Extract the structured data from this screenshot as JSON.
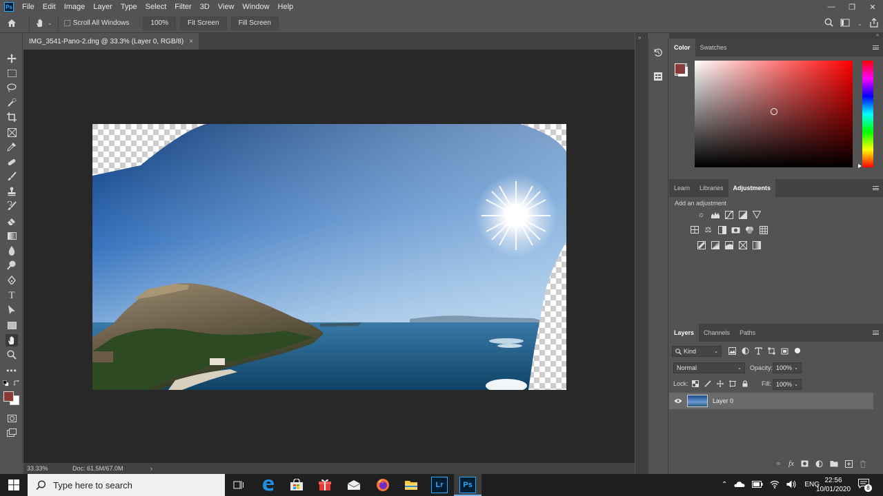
{
  "app": {
    "logo": "Ps",
    "menu": [
      "File",
      "Edit",
      "Image",
      "Layer",
      "Type",
      "Select",
      "Filter",
      "3D",
      "View",
      "Window",
      "Help"
    ],
    "window_controls": [
      "minimize",
      "restore",
      "close"
    ]
  },
  "options_bar": {
    "scroll_all_windows_label": "Scroll All Windows",
    "zoom_value": "100%",
    "fit_screen_label": "Fit Screen",
    "fill_screen_label": "Fill Screen"
  },
  "document": {
    "tab_title": "IMG_3541-Pano-2.dng @ 33.3% (Layer 0, RGB/8)",
    "close_glyph": "×",
    "zoom_status": "33.33%",
    "doc_info": "Doc: 61.5M/67.0M",
    "status_arrow": "›"
  },
  "colors": {
    "foreground": "#8b3a3a",
    "background": "#ffffff",
    "accent": "#31a8ff"
  },
  "color_panel": {
    "tabs": [
      "Color",
      "Swatches"
    ],
    "active_tab": "Color"
  },
  "adjustments_panel": {
    "tabs": [
      "Learn",
      "Libraries",
      "Adjustments"
    ],
    "active_tab": "Adjustments",
    "heading": "Add an adjustment",
    "row1": [
      "brightness-contrast-icon",
      "levels-icon",
      "curves-icon",
      "exposure-icon",
      "vibrance-icon"
    ],
    "row2": [
      "hue-saturation-icon",
      "color-balance-icon",
      "black-white-icon",
      "photo-filter-icon",
      "channel-mixer-icon",
      "color-lookup-icon"
    ],
    "row3": [
      "invert-icon",
      "posterize-icon",
      "threshold-icon",
      "selective-color-icon",
      "gradient-map-icon"
    ]
  },
  "layers_panel": {
    "tabs": [
      "Layers",
      "Channels",
      "Paths"
    ],
    "active_tab": "Layers",
    "filter_kind": "Kind",
    "blend_mode": "Normal",
    "opacity_label": "Opacity:",
    "opacity_value": "100%",
    "lock_label": "Lock:",
    "fill_label": "Fill:",
    "fill_value": "100%",
    "layers": [
      {
        "name": "Layer 0",
        "visible": true
      }
    ]
  },
  "taskbar": {
    "search_placeholder": "Type here to search",
    "apps": [
      "task-view-icon",
      "edge-icon",
      "store-icon",
      "gift-icon",
      "mail-icon",
      "firefox-icon",
      "file-explorer-icon",
      "lightroom-icon",
      "photoshop-icon"
    ],
    "lr_label": "Lr",
    "ps_label": "Ps",
    "language": "ENG",
    "time": "22:56",
    "date": "10/01/2020",
    "notification_count": "8"
  }
}
